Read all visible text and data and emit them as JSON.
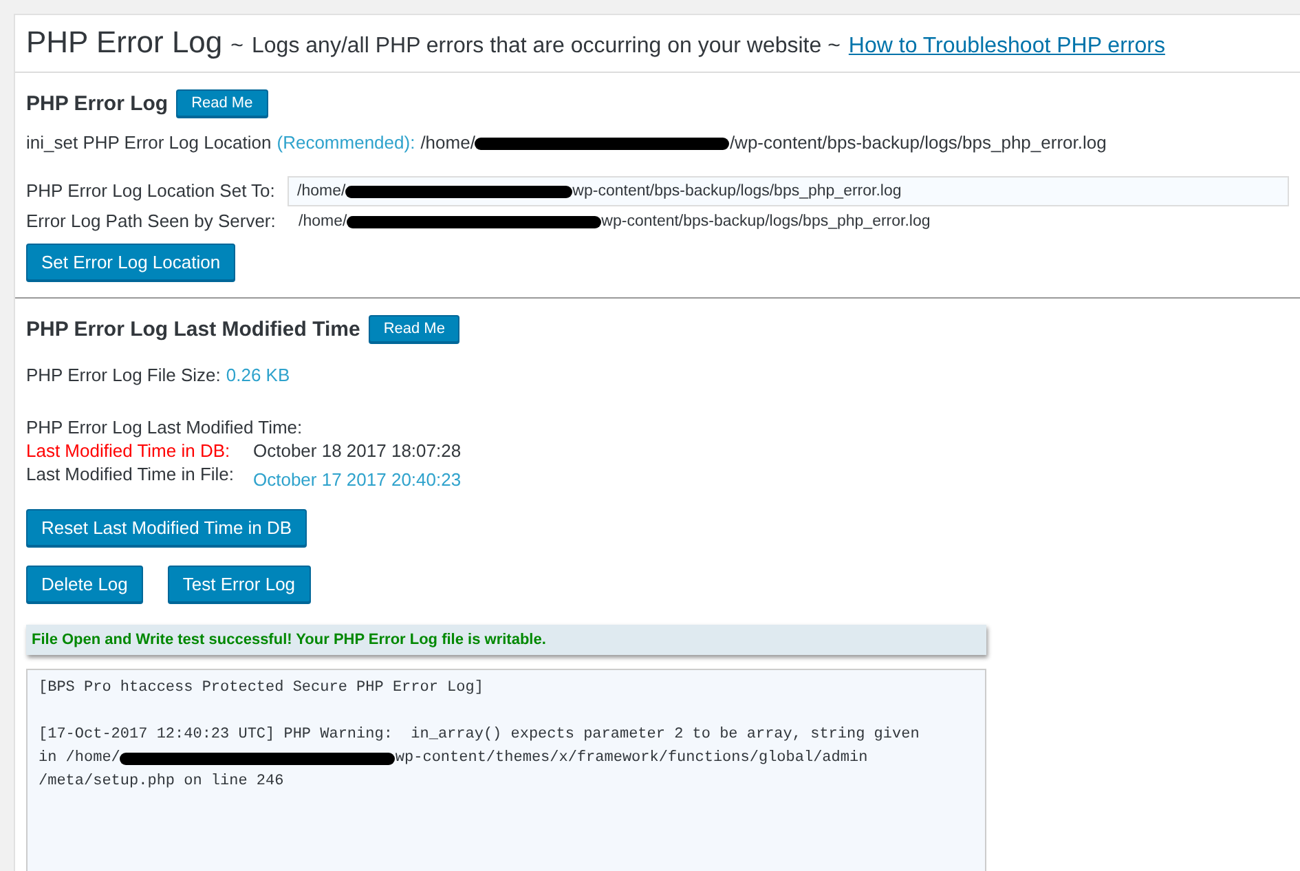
{
  "header": {
    "title": "PHP Error Log",
    "separator": "~",
    "subtitle": "Logs any/all PHP errors that are occurring on your website ~",
    "link": "How to Troubleshoot PHP errors"
  },
  "location_section": {
    "heading": "PHP Error Log",
    "read_me": "Read Me",
    "ini_set": {
      "label": "ini_set PHP Error Log Location",
      "note": "(Recommended):",
      "path_start": "/home/",
      "path_end": "/wp-content/bps-backup/logs/bps_php_error.log"
    },
    "set_to": {
      "label": "PHP Error Log Location Set To:",
      "value_start": "/home/",
      "value_end": "wp-content/bps-backup/logs/bps_php_error.log"
    },
    "seen_by_server": {
      "label": "Error Log Path Seen by Server:",
      "path_start": "/home/",
      "path_end": "wp-content/bps-backup/logs/bps_php_error.log"
    },
    "button": "Set Error Log Location"
  },
  "modified_section": {
    "heading": "PHP Error Log Last Modified Time",
    "read_me": "Read Me",
    "file_size": {
      "label": "PHP Error Log File Size:",
      "value": "0.26 KB"
    },
    "times_heading": "PHP Error Log Last Modified Time:",
    "times": [
      {
        "label": "Last Modified Time in DB:",
        "value": "October 18 2017 18:07:28",
        "kind": "alert"
      },
      {
        "label": "Last Modified Time in File:",
        "value": "October 17 2017 20:40:23",
        "kind": "info"
      }
    ],
    "reset_button": "Reset Last Modified Time in DB",
    "buttons": [
      "Delete Log",
      "Test Error Log"
    ],
    "notice": "File Open and Write test successful! Your PHP Error Log file is writable.",
    "log": {
      "header": "[BPS Pro htaccess Protected Secure PHP Error Log]",
      "entry_line": "[17-Oct-2017 12:40:23 UTC] PHP Warning:  in_array() expects parameter 2 to be array, string given",
      "path_start": "in /home/",
      "path_end": "wp-content/themes/x/framework/functions/global/admin",
      "last_line": "/meta/setup.php on line 246"
    }
  }
}
